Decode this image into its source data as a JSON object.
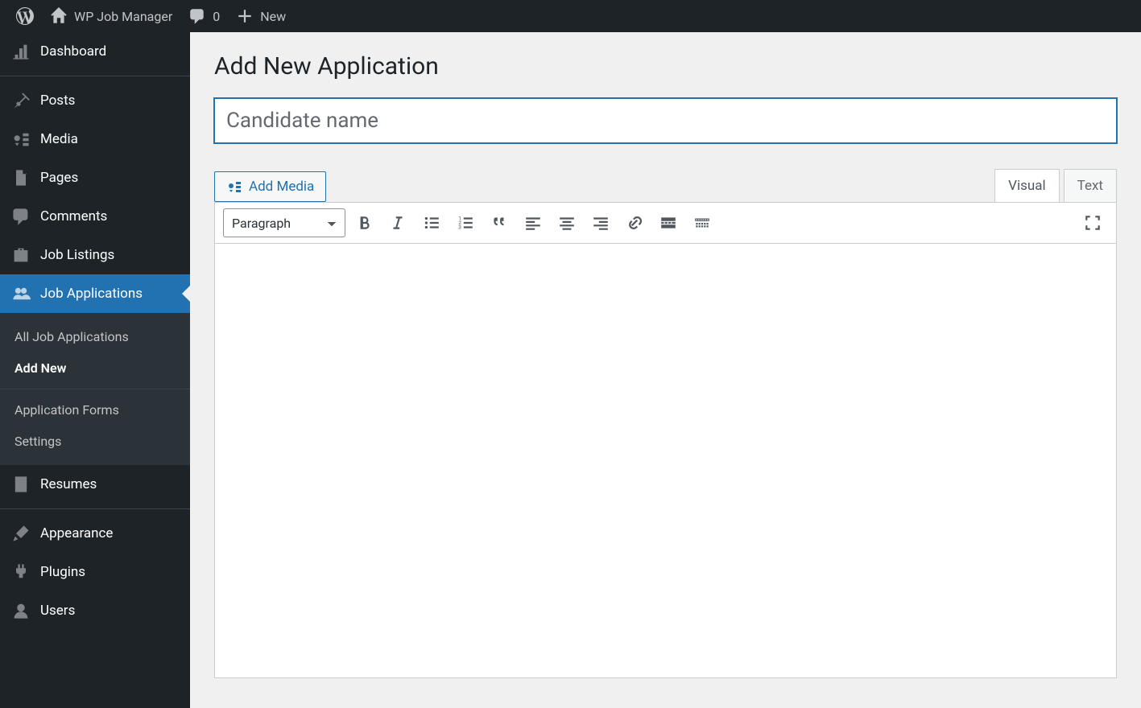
{
  "adminbar": {
    "site_title": "WP Job Manager",
    "comments_count": "0",
    "new_label": "New"
  },
  "sidebar": {
    "items": [
      {
        "label": "Dashboard",
        "icon": "dashboard"
      },
      {
        "label": "Posts",
        "icon": "pin"
      },
      {
        "label": "Media",
        "icon": "media"
      },
      {
        "label": "Pages",
        "icon": "page"
      },
      {
        "label": "Comments",
        "icon": "comment"
      },
      {
        "label": "Job Listings",
        "icon": "briefcase"
      },
      {
        "label": "Job Applications",
        "icon": "users",
        "current": true
      },
      {
        "label": "Resumes",
        "icon": "document"
      },
      {
        "label": "Appearance",
        "icon": "brush"
      },
      {
        "label": "Plugins",
        "icon": "plug"
      },
      {
        "label": "Users",
        "icon": "user"
      }
    ],
    "submenu": [
      {
        "label": "All Job Applications"
      },
      {
        "label": "Add New",
        "current": true
      },
      {
        "label": "Application Forms"
      },
      {
        "label": "Settings"
      }
    ]
  },
  "page": {
    "heading": "Add New Application",
    "title_placeholder": "Candidate name",
    "add_media_label": "Add Media",
    "editor_tabs": {
      "visual": "Visual",
      "text": "Text"
    },
    "format_select": "Paragraph"
  }
}
